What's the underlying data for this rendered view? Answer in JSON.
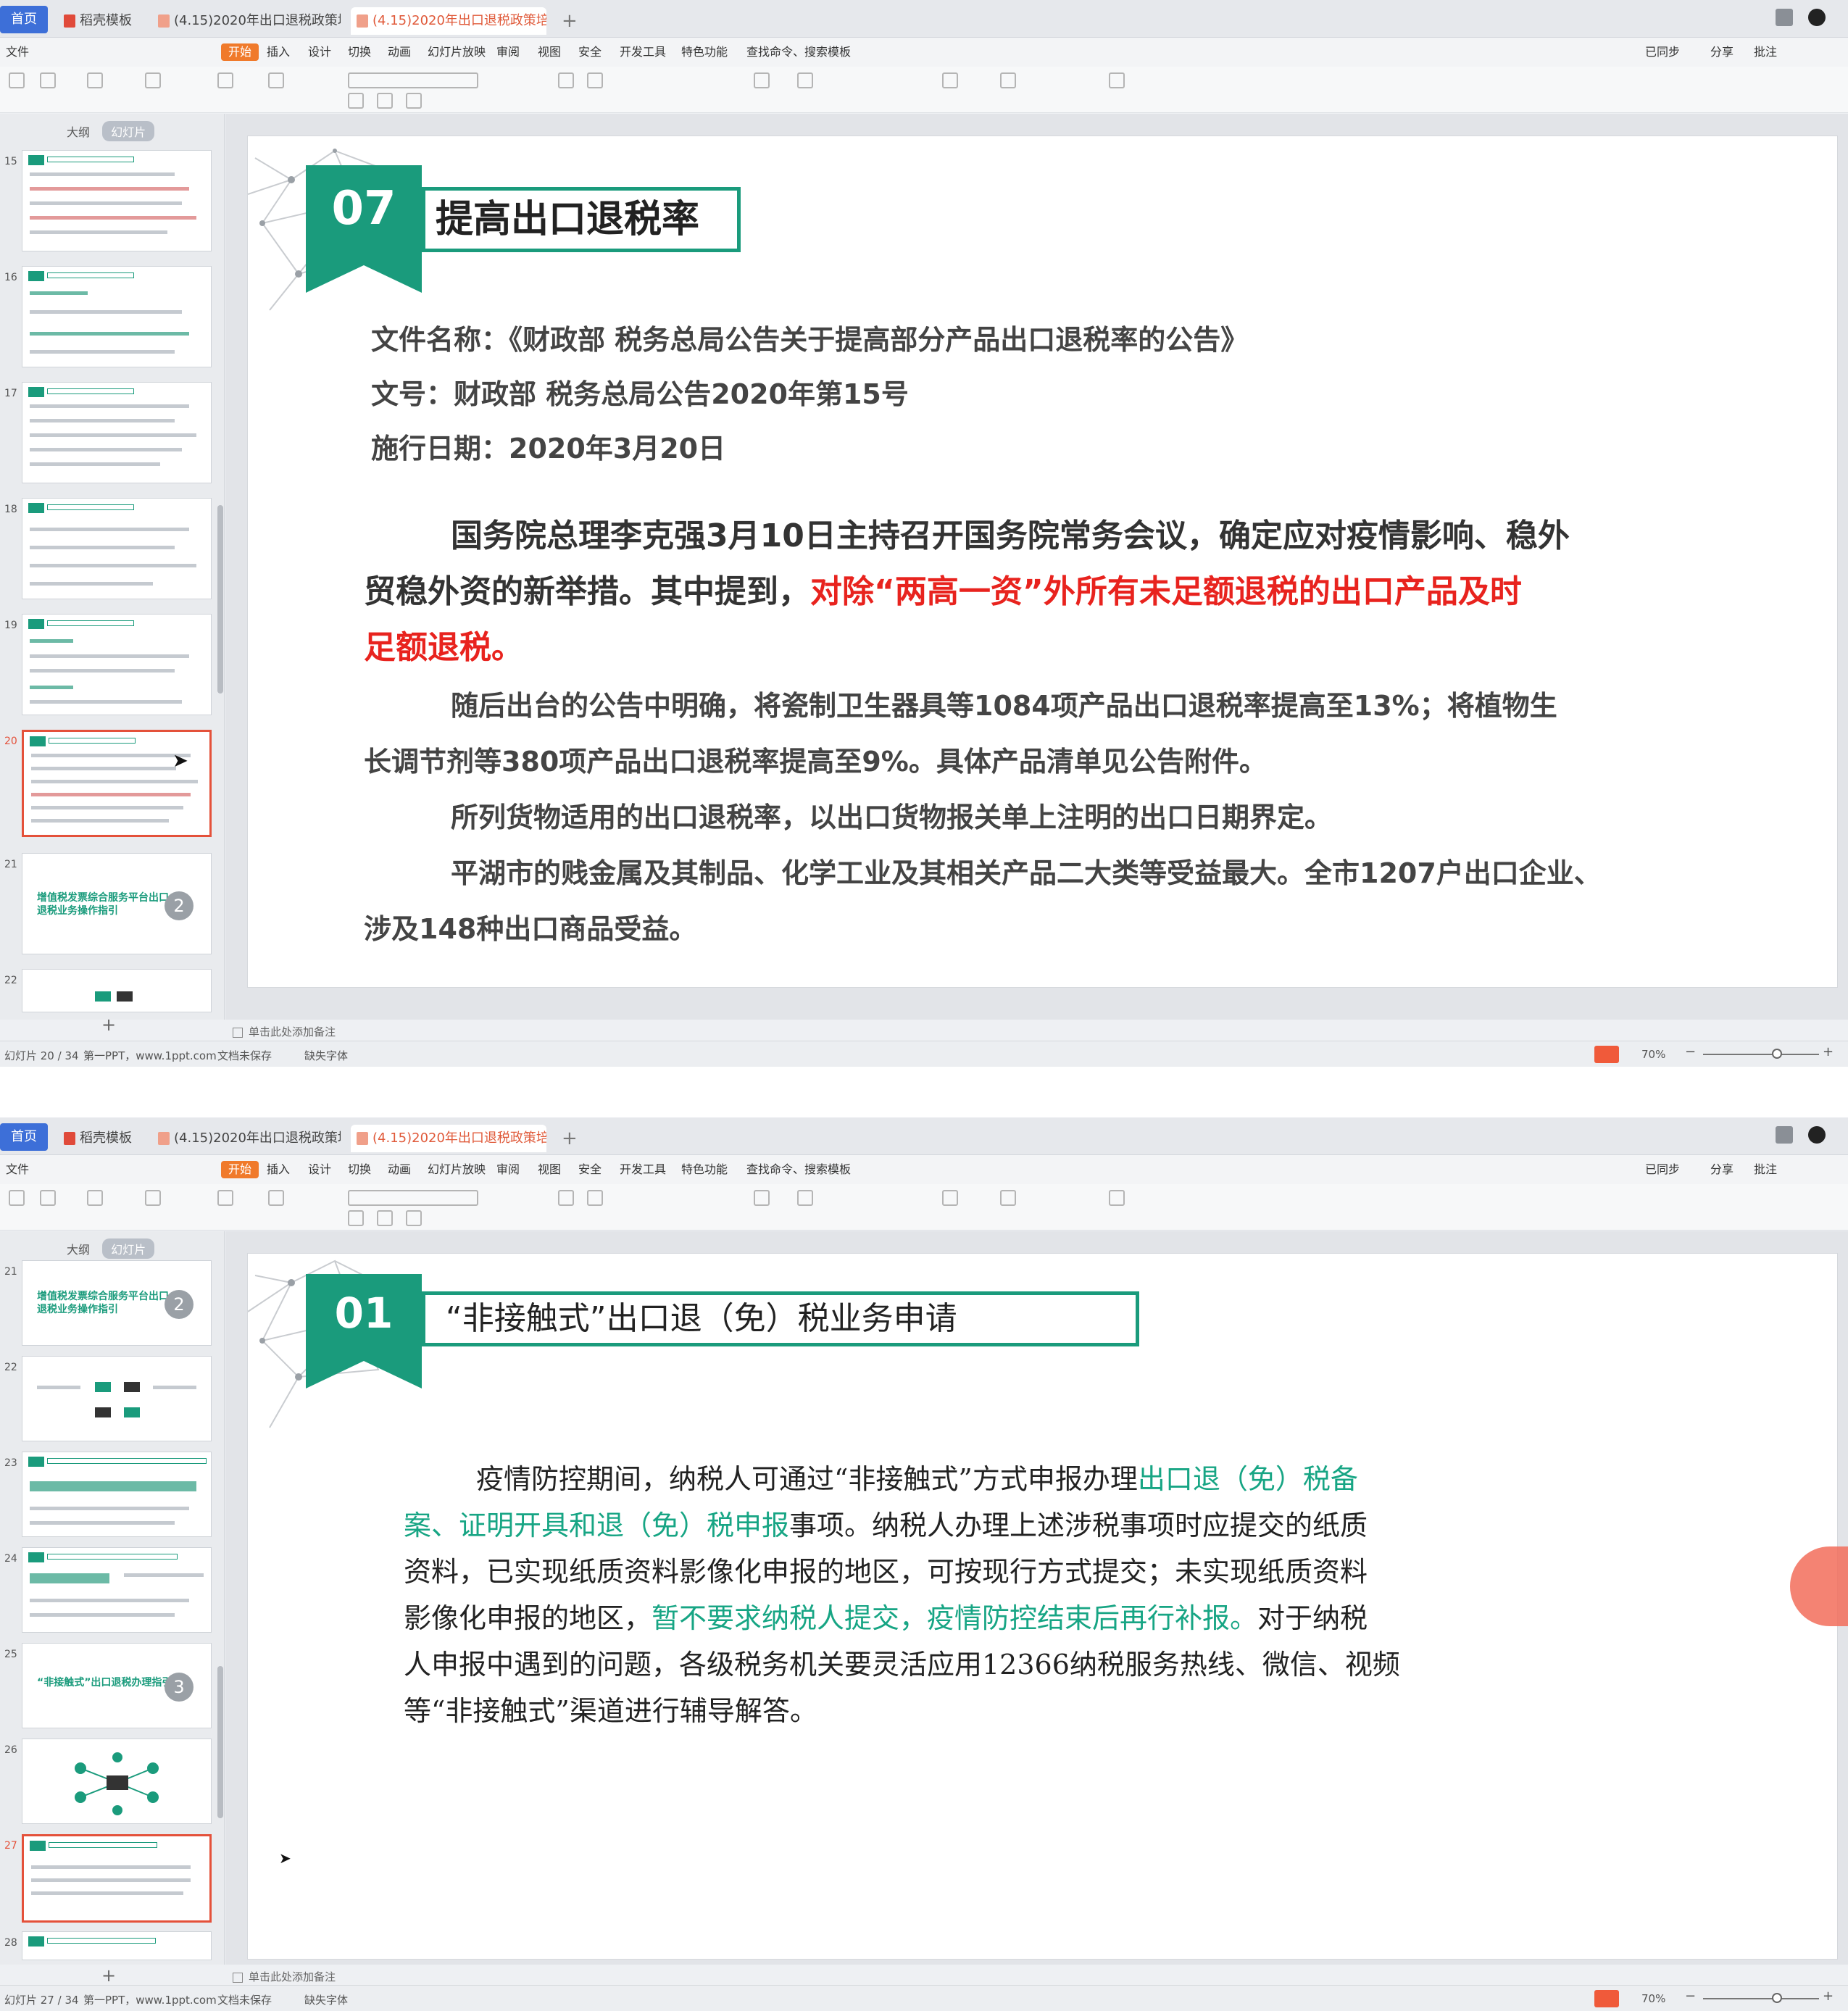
{
  "app": {
    "home_tab": "首页",
    "tabs": [
      {
        "label": "稻壳模板",
        "active": false
      },
      {
        "label": "(4.15)2020年出口退税政策培训.ppt",
        "active": false
      },
      {
        "label": "(4.15)2020年出口退税政策培训.ppt",
        "active": true
      }
    ],
    "menu": [
      "文件",
      "开始",
      "插入",
      "设计",
      "切换",
      "动画",
      "幻灯片放映",
      "审阅",
      "视图",
      "安全",
      "开发工具",
      "特色功能",
      "查找命令、搜索模板"
    ],
    "menu_right": [
      "已同步",
      "分享",
      "批注"
    ],
    "sidebar_tabs": [
      "大纲",
      "幻灯片"
    ],
    "accent": "#1a9b7c",
    "highlight_red": "#e8231e"
  },
  "window1": {
    "thumb_numbers": [
      "15",
      "16",
      "17",
      "18",
      "19",
      "20",
      "21",
      "22"
    ],
    "thumb21_text": "增值税发票综合服务平台出口退税业务操作指引",
    "thumb21_badge": "2",
    "slide": {
      "number": "07",
      "title": "提高出口退税率",
      "meta": [
        "文件名称：《财政部 税务总局公告关于提高部分产品出口退税率的公告》",
        "文号：财政部 税务总局公告2020年第15号",
        "施行日期：2020年3月20日"
      ],
      "p1_line1": "国务院总理李克强3月10日主持召开国务院常务会议，确定应对疫情影响、稳外",
      "p1_line2_plain": "贸稳外资的新举措。其中提到，",
      "p1_line2_red": "对除“两高一资”外所有未足额退税的出口产品及时",
      "p1_line3_red": "足额退税。",
      "p2_line1": "随后出台的公告中明确，将瓷制卫生器具等1084项产品出口退税率提高至13%；将植物生",
      "p2_line2": "长调节剂等380项产品出口退税率提高至9%。具体产品清单见公告附件。",
      "p3_line1": "所列货物适用的出口退税率，以出口货物报关单上注明的出口日期界定。",
      "p4_line1": "平湖市的贱金属及其制品、化学工业及其相关产品二大类等受益最大。全市1207户出口企业、",
      "p4_line2": "涉及148种出口商品受益。"
    },
    "notes": "单击此处添加备注",
    "status": {
      "slide_pos": "幻灯片 20 / 34",
      "theme": "第一PPT，www.1ppt.com",
      "backup": "文档未保存",
      "font": "缺失字体",
      "zoom": "70%"
    }
  },
  "window2": {
    "thumb_numbers": [
      "21",
      "22",
      "23",
      "24",
      "25",
      "26",
      "27",
      "28"
    ],
    "thumb21_text": "增值税发票综合服务平台出口退税业务操作指引",
    "thumb21_badge": "2",
    "thumb25_text": "“非接触式”出口退税办理指引",
    "thumb25_badge": "3",
    "slide": {
      "number": "01",
      "title": "“非接触式”出口退（免）税业务申请",
      "l1_plain": "疫情防控期间，纳税人可通过“非接触式”方式申报办理",
      "l1_teal": "出口退（免）税备",
      "l2_teal": "案、证明开具和退（免）税申报",
      "l2_plain": "事项。纳税人办理上述涉税事项时应提交的纸质",
      "l3": "资料，已实现纸质资料影像化申报的地区，可按现行方式提交；未实现纸质资料",
      "l4_plain": "影像化申报的地区，",
      "l4_teal": "暂不要求纳税人提交，疫情防控结束后再行补报。",
      "l4_tail": "对于纳税",
      "l5": "人申报中遇到的问题，各级税务机关要灵活应用12366纳税服务热线、微信、视频",
      "l6": "等“非接触式”渠道进行辅导解答。"
    },
    "notes": "单击此处添加备注",
    "status": {
      "slide_pos": "幻灯片 27 / 34",
      "theme": "第一PPT，www.1ppt.com",
      "backup": "文档未保存",
      "font": "缺失字体",
      "zoom": "70%"
    }
  }
}
